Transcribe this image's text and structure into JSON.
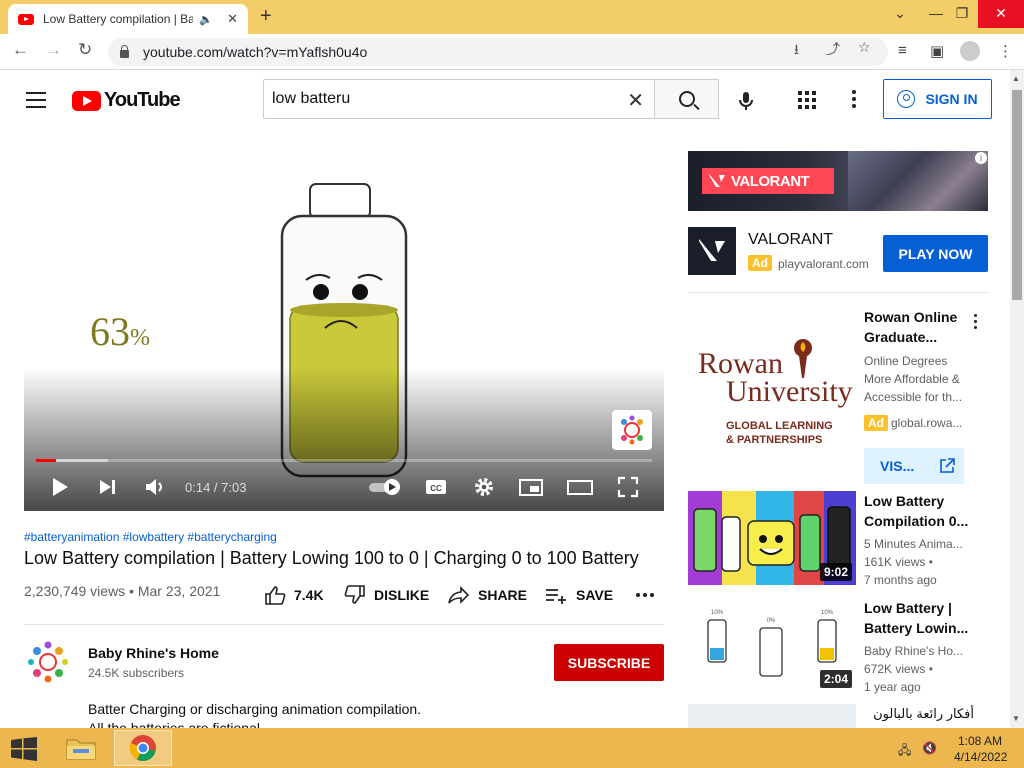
{
  "browser": {
    "tab_title": "Low Battery compilation | Ba",
    "url": "youtube.com/watch?v=mYaflsh0u4o"
  },
  "youtube": {
    "logo_text": "YouTube",
    "search_query": "low batteru",
    "sign_in_label": "SIGN IN"
  },
  "video": {
    "overlay_percent": "63",
    "overlay_percent_sign": "%",
    "time": "0:14 / 7:03",
    "progress_fraction": 0.033,
    "buffered_fraction": 0.117,
    "hashtags": "#batteryanimation #lowbattery #batterycharging",
    "title": "Low Battery compilation | Battery Lowing 100 to 0 | Charging 0 to 100 Battery",
    "views_date": "2,230,749 views • Mar 23, 2021",
    "likes": "7.4K",
    "dislike_label": "DISLIKE",
    "share_label": "SHARE",
    "save_label": "SAVE"
  },
  "channel": {
    "name": "Baby Rhine's Home",
    "subscribers": "24.5K subscribers",
    "subscribe_label": "SUBSCRIBE",
    "description_line1": "Batter Charging or discharging animation compilation.",
    "description_line2": "All the batteries are fictional."
  },
  "ad": {
    "banner_text": "VALORANT",
    "name": "VALORANT",
    "tag": "Ad",
    "domain": "playvalorant.com",
    "cta": "PLAY NOW"
  },
  "sidebar": {
    "promo": {
      "title_line1": "Rowan Online",
      "title_line2": "Graduate...",
      "meta_line1": "Online Degrees",
      "meta_line2": "More Affordable &",
      "meta_line3": "Accessible for th...",
      "tag": "Ad",
      "domain": "global.rowa...",
      "cta": "VIS...",
      "thumb_line1": "Rowan",
      "thumb_line2": "University",
      "thumb_line3": "GLOBAL LEARNING",
      "thumb_line4": "& PARTNERSHIPS"
    },
    "videos": [
      {
        "title_line1": "Low Battery",
        "title_line2": "Compilation 0...",
        "channel": "5 Minutes Anima...",
        "views": "161K views •",
        "age": "7 months ago",
        "duration": "9:02"
      },
      {
        "title_line1": "Low Battery |",
        "title_line2": "Battery Lowin...",
        "channel": "Baby Rhine's Ho...",
        "views": "672K views •",
        "age": "1 year ago",
        "duration": "2:04",
        "thumb_labels": [
          "10%",
          "0%",
          "10%"
        ]
      },
      {
        "title_line1": "أفكار رائعة بالبالون"
      }
    ]
  },
  "taskbar": {
    "time": "1:08 AM",
    "date": "4/14/2022"
  }
}
